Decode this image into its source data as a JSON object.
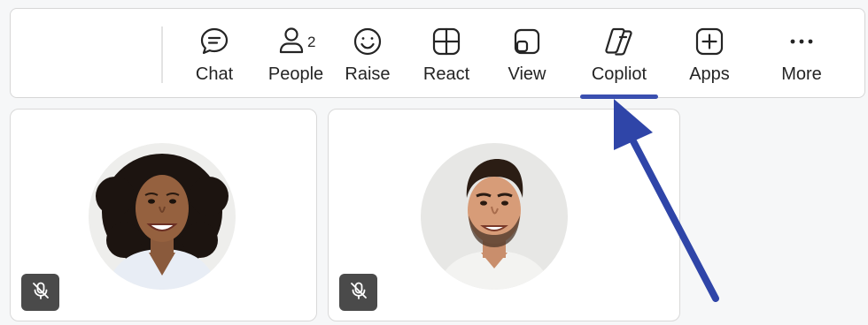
{
  "toolbar": {
    "buttons": [
      {
        "id": "chat",
        "label": "Chat",
        "icon": "chat-icon"
      },
      {
        "id": "people",
        "label": "People",
        "icon": "people-icon",
        "badge": "2"
      },
      {
        "id": "raise",
        "label": "Raise",
        "icon": "raise-hand-icon"
      },
      {
        "id": "react",
        "label": "React",
        "icon": "react-icon"
      },
      {
        "id": "view",
        "label": "View",
        "icon": "view-icon"
      },
      {
        "id": "copilot",
        "label": "Copliot",
        "icon": "copilot-icon",
        "active": true
      },
      {
        "id": "apps",
        "label": "Apps",
        "icon": "apps-icon"
      },
      {
        "id": "more",
        "label": "More",
        "icon": "more-icon"
      }
    ]
  },
  "participants": [
    {
      "name_icon": "participant-woman-avatar",
      "muted": true
    },
    {
      "name_icon": "participant-man-avatar",
      "muted": true
    }
  ],
  "colors": {
    "accent": "#3a4fb0",
    "arrow": "#2f45a8",
    "icon": "#242424",
    "mute_badge": "#4a4a4a"
  }
}
